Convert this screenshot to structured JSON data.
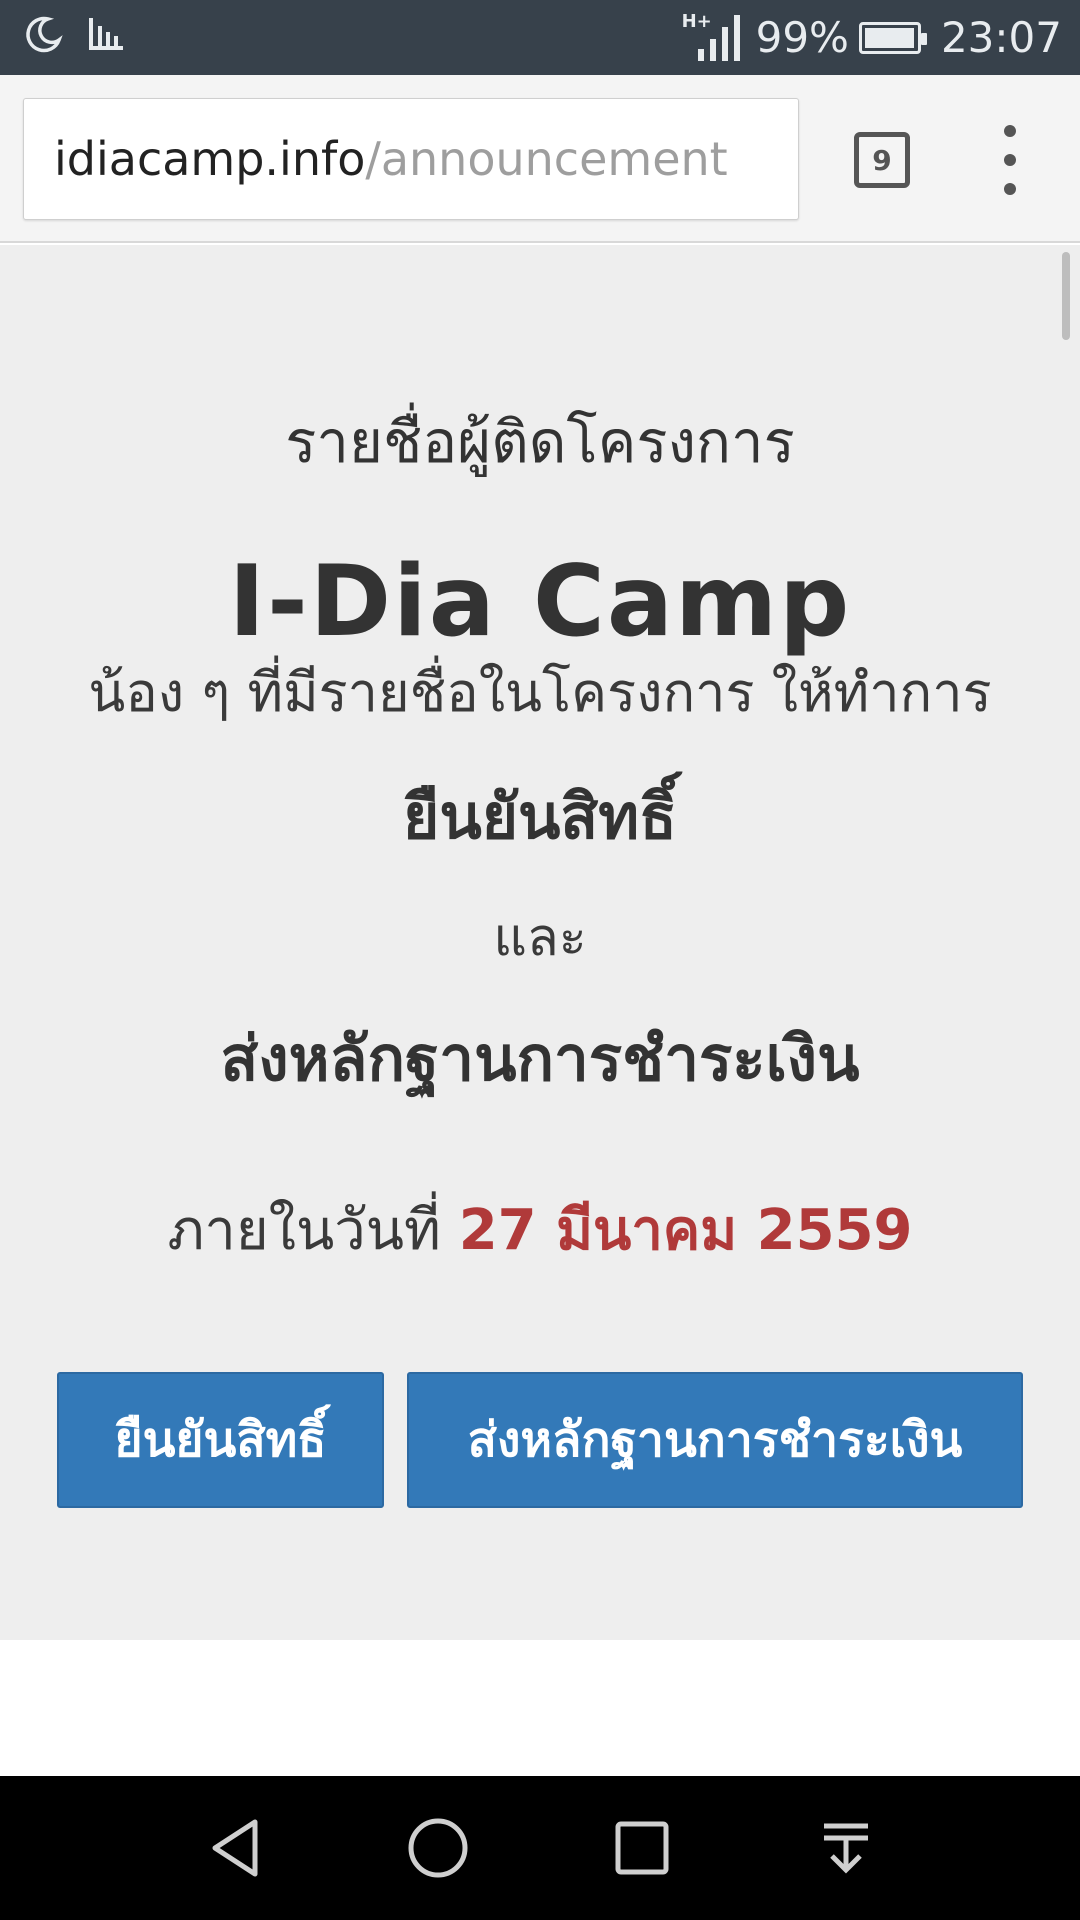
{
  "status_bar": {
    "network": "H+",
    "battery_percent": "99%",
    "battery_level": 0.99,
    "time": "23:07",
    "icons": [
      "moon-icon",
      "stats-icon",
      "signal-icon",
      "battery-icon"
    ]
  },
  "browser": {
    "url_host": "idiacamp.info",
    "url_path": "/announcement",
    "tab_count": "9"
  },
  "announcement": {
    "subtitle": "รายชื่อผู้ติดโครงการ",
    "title": "I-Dia Camp",
    "intro": "น้อง ๆ ที่มีรายชื่อในโครงการ ให้ทำการ",
    "action_confirm": "ยืนยันสิทธิ์",
    "and": "และ",
    "action_payment": "ส่งหลักฐานการชำระเงิน",
    "deadline_prefix": "ภายในวันที่",
    "deadline_date": "27 มีนาคม 2559"
  },
  "buttons": {
    "confirm": "ยืนยันสิทธิ์",
    "payment": "ส่งหลักฐานการชำระเงิน"
  },
  "colors": {
    "status_bar": "#37414b",
    "button": "#3379b8",
    "deadline": "#b03a3a",
    "page_bg": "#eeeeee"
  },
  "nav_bar": {
    "icons": [
      "back-icon",
      "home-icon",
      "recents-icon",
      "notification-pull-icon"
    ]
  }
}
